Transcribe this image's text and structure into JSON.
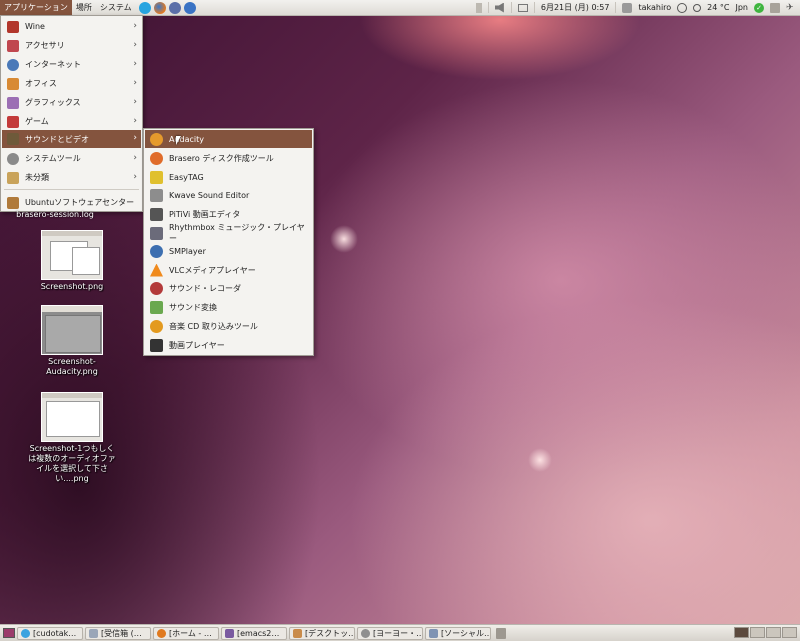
{
  "top_panel": {
    "menus": [
      "アプリケーション",
      "場所",
      "システム"
    ],
    "clock": "6月21日 (月)  0:57",
    "user": "takahiro",
    "weather": "24 °C",
    "keyboard": "Jpn"
  },
  "app_menu": {
    "items": [
      {
        "label": "Wine",
        "icon": "wine-icon",
        "color": "#b2362b"
      },
      {
        "label": "アクセサリ",
        "icon": "accessories-icon",
        "color": "#c0474f"
      },
      {
        "label": "インターネット",
        "icon": "globe-icon",
        "color": "#4a79b8"
      },
      {
        "label": "オフィス",
        "icon": "office-icon",
        "color": "#d88a34"
      },
      {
        "label": "グラフィックス",
        "icon": "graphics-icon",
        "color": "#9c6fb4"
      },
      {
        "label": "ゲーム",
        "icon": "cards-icon",
        "color": "#c33a3a"
      },
      {
        "label": "サウンドとビデオ",
        "icon": "multimedia-icon",
        "color": "#6e5a3a"
      },
      {
        "label": "システムツール",
        "icon": "gear-icon",
        "color": "#8a8a8a"
      },
      {
        "label": "未分類",
        "icon": "package-icon",
        "color": "#c9a35a"
      }
    ],
    "software_center": "Ubuntuソフトウェアセンター"
  },
  "sub_menu": {
    "items": [
      {
        "label": "Audacity",
        "icon": "audacity-icon",
        "color": "#e59a2c"
      },
      {
        "label": "Brasero ディスク作成ツール",
        "icon": "brasero-icon",
        "color": "#e06c2a"
      },
      {
        "label": "EasyTAG",
        "icon": "easytag-icon",
        "color": "#e0c02e"
      },
      {
        "label": "Kwave Sound Editor",
        "icon": "kwave-icon",
        "color": "#8d8d8d"
      },
      {
        "label": "PiTiVi 動画エディタ",
        "icon": "pitivi-icon",
        "color": "#555555"
      },
      {
        "label": "Rhythmbox ミュージック・プレイヤー",
        "icon": "rhythmbox-icon",
        "color": "#6b6b7a"
      },
      {
        "label": "SMPlayer",
        "icon": "smplayer-icon",
        "color": "#3d6fb0"
      },
      {
        "label": "VLCメディアプレイヤー",
        "icon": "vlc-icon",
        "color": "#f08a1c"
      },
      {
        "label": "サウンド・レコーダ",
        "icon": "microphone-icon",
        "color": "#b33a3a"
      },
      {
        "label": "サウンド変換",
        "icon": "sound-converter-icon",
        "color": "#6aa84f"
      },
      {
        "label": "音楽 CD 取り込みツール",
        "icon": "cd-ripper-icon",
        "color": "#e39a1f"
      },
      {
        "label": "動画プレイヤー",
        "icon": "movie-player-icon",
        "color": "#333333"
      }
    ]
  },
  "desktop": {
    "cut_label": "brasero-session.log",
    "icons": [
      {
        "label": "Screenshot.png"
      },
      {
        "label": "Screenshot-Audacity.png"
      },
      {
        "label": "Screenshot-1つもしくは複数のオーディオファイルを選択して下さい....png"
      }
    ]
  },
  "taskbar": {
    "tasks": [
      {
        "label": "[cudotak…",
        "color": "#3aa3e0"
      },
      {
        "label": "[受信箱 (…",
        "color": "#9aa6b8"
      },
      {
        "label": "[ホーム - …",
        "color": "#e07a1f"
      },
      {
        "label": "[emacs2…",
        "color": "#7a5aa0"
      },
      {
        "label": "[デスクトッ…",
        "color": "#c98b4a"
      },
      {
        "label": "[ヨーヨー・…",
        "color": "#8f8f8f"
      },
      {
        "label": "[ソーシャル…",
        "color": "#7f93b3"
      }
    ]
  }
}
